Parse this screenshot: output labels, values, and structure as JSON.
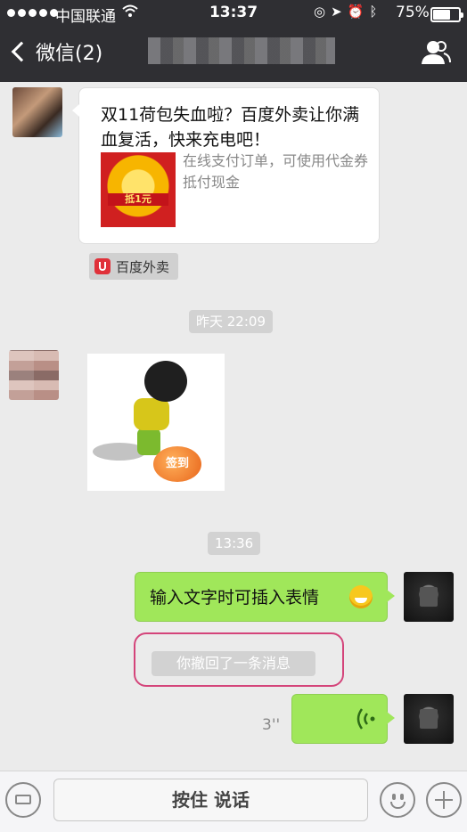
{
  "status_bar": {
    "carrier": "中国联通",
    "time": "13:37",
    "battery_percent": "75%"
  },
  "nav": {
    "back_label": "微信(2)",
    "title": ""
  },
  "messages": {
    "card": {
      "title": "双11荷包失血啦？百度外卖让你满血复活，快来充电吧！",
      "description": "在线支付订单，可使用代金券抵付现金",
      "source": "百度外卖",
      "image_text": "抵1元"
    },
    "timestamp_1": "昨天 22:09",
    "sticker_text": "签到",
    "timestamp_2": "13:36",
    "my_text": "输入文字时可插入表情",
    "recalled_notice": "你撤回了一条消息",
    "voice_duration": "3''"
  },
  "input_bar": {
    "hold_to_talk": "按住 说话"
  },
  "colors": {
    "nav_bg": "#2f2f33",
    "chat_bg": "#ebebeb",
    "my_bubble": "#a0e75a",
    "highlight_border": "#d4447a"
  },
  "icons": [
    "wifi-icon",
    "location-icon",
    "alarm-icon",
    "bluetooth-icon",
    "battery-icon",
    "back-chevron-icon",
    "profile-icon",
    "keyboard-icon",
    "emoji-icon",
    "plus-icon",
    "voice-wave-icon"
  ]
}
